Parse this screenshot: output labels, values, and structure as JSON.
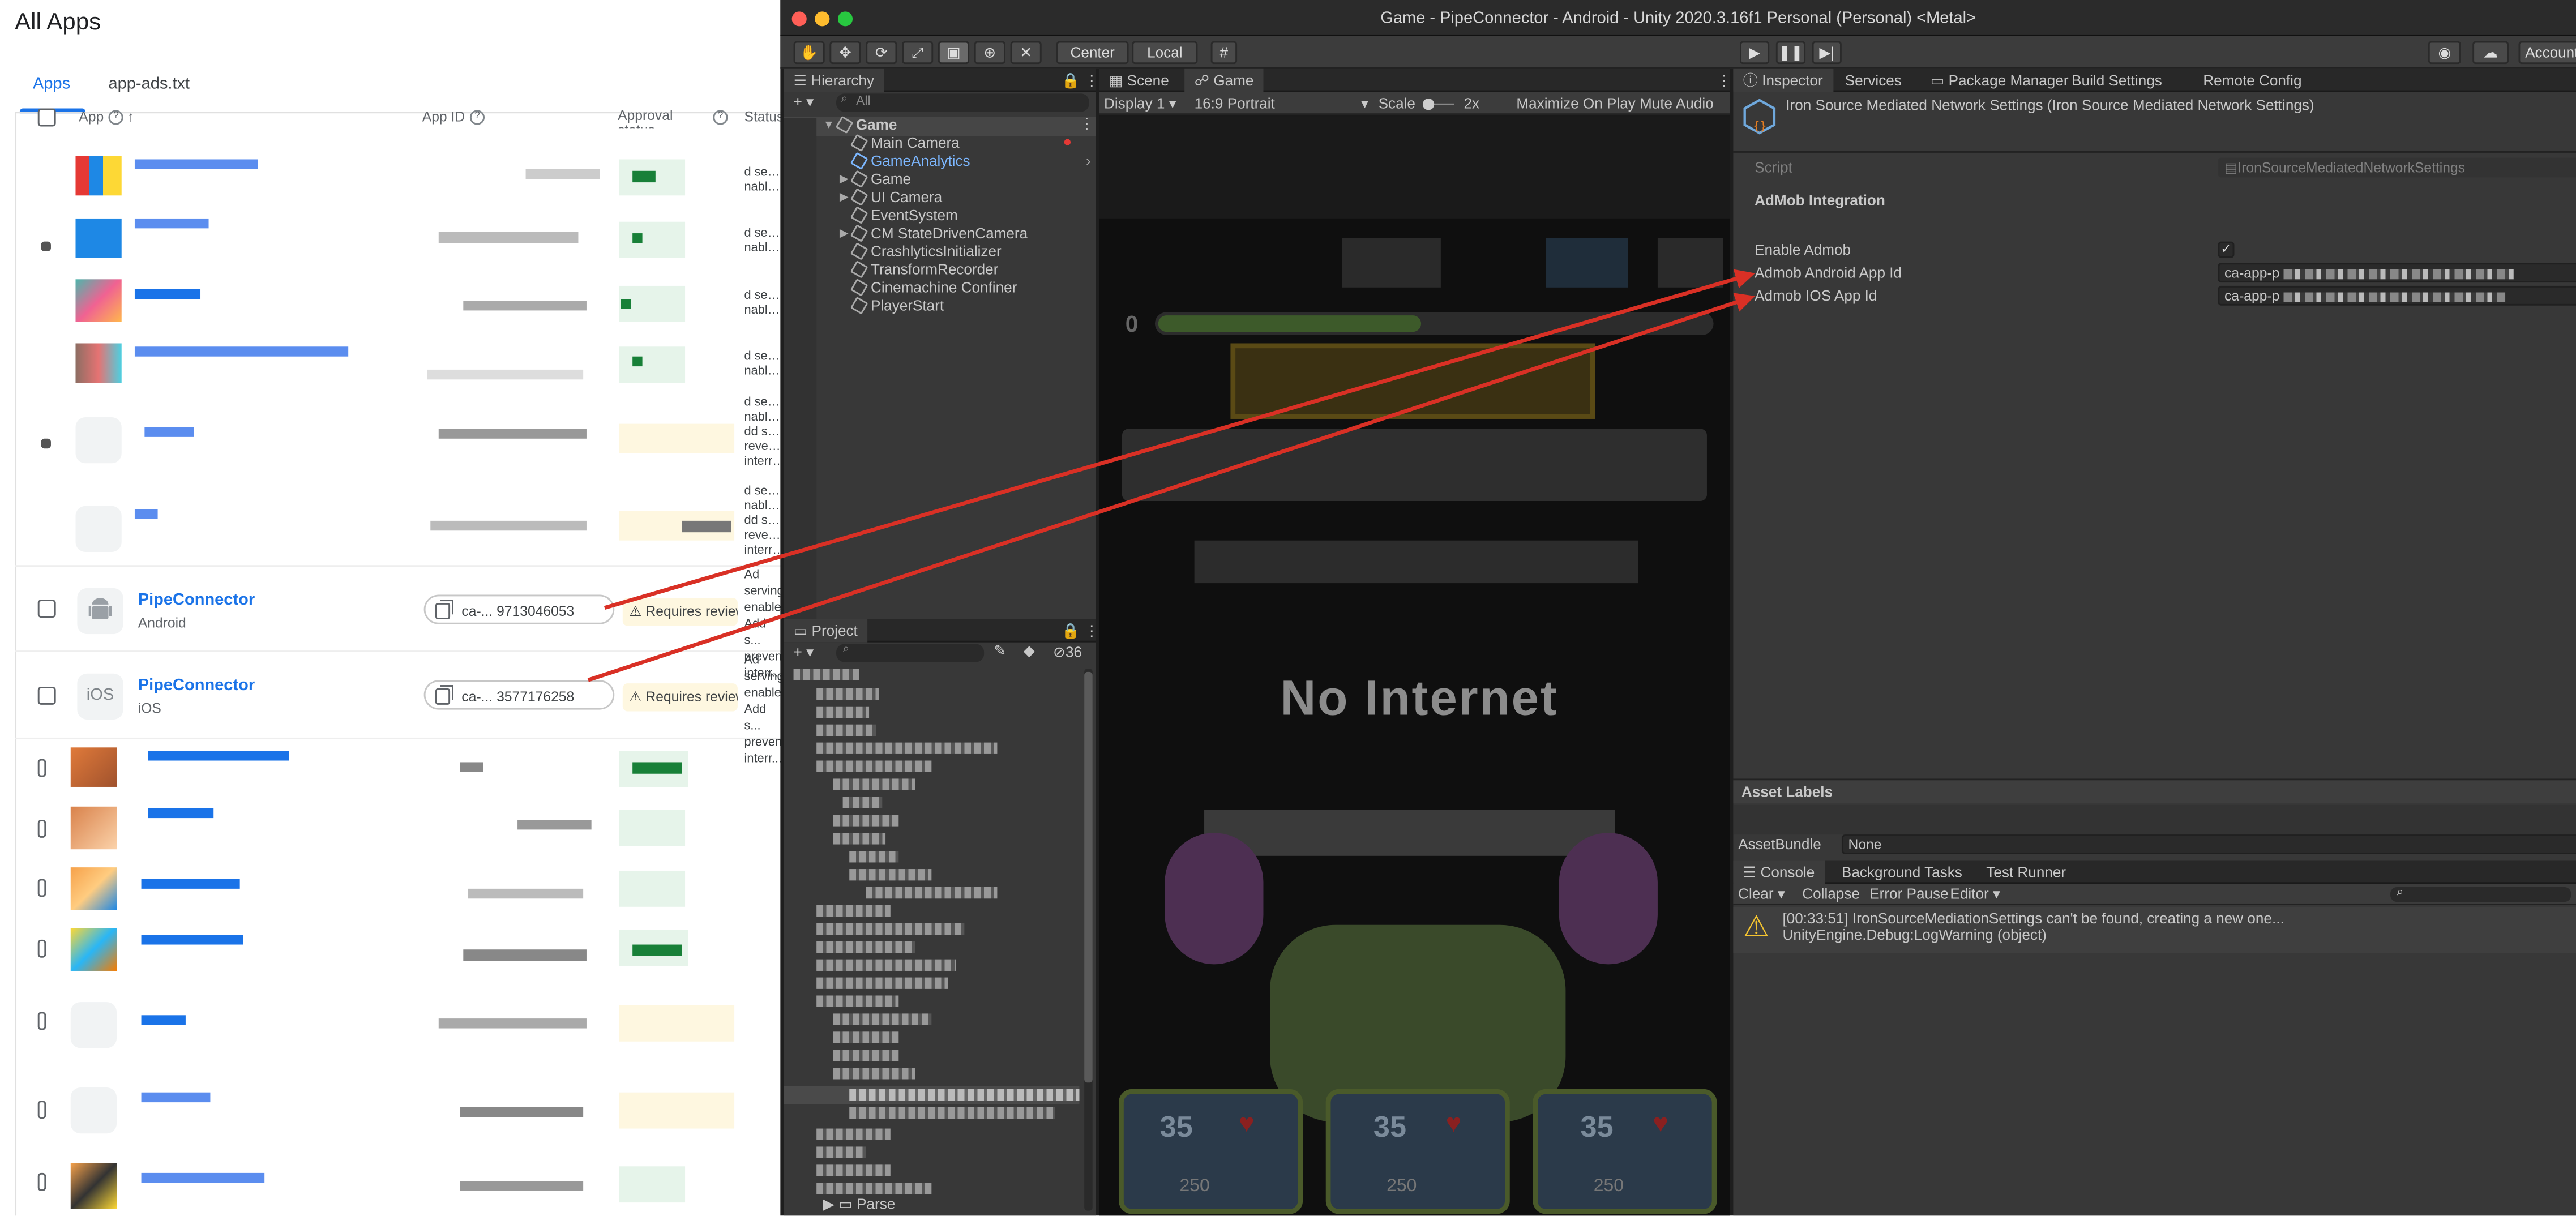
{
  "admob": {
    "page_title": "All Apps",
    "tabs": [
      {
        "label": "Apps"
      },
      {
        "label": "app-ads.txt"
      }
    ],
    "columns": {
      "app": "App",
      "app_id": "App ID",
      "approval": "Approval status",
      "status": "Status"
    },
    "rows": [
      {
        "name": "PipeConnector",
        "platform": "Android",
        "app_id": "ca-... 9713046053",
        "approval": "Requires review",
        "status": "Ad serving enabled. Add s... prevent... interr..."
      },
      {
        "name": "PipeConnector",
        "platform": "iOS",
        "app_id": "ca-... 3577176258",
        "approval": "Requires review",
        "status": "Ad serving enabled. Add s... prevent... interr..."
      }
    ],
    "ios_icon_text": "iOS"
  },
  "unity": {
    "window_title": "Game - PipeConnector - Android - Unity 2020.3.16f1 Personal (Personal) <Metal>",
    "toolbar": {
      "center": "Center",
      "local": "Local",
      "account": "Account"
    },
    "hierarchy": {
      "tab": "Hierarchy",
      "search_placeholder": "All",
      "scene": "Game",
      "items": [
        "Main Camera",
        "GameAnalytics",
        "Game",
        "UI Camera",
        "EventSystem",
        "CM StateDrivenCamera",
        "CrashlyticsInitializer",
        "TransformRecorder",
        "Cinemachine Confiner",
        "PlayerStart"
      ]
    },
    "project": {
      "tab": "Project",
      "count": "36",
      "bottom_item": "Parse"
    },
    "game": {
      "tabs": [
        "Scene",
        "Game"
      ],
      "display": "Display 1",
      "aspect": "16:9 Portrait",
      "scale_label": "Scale",
      "scale_value": "2x",
      "maximize": "Maximize On Play",
      "mute": "Mute Audio",
      "progress_left": "0",
      "no_internet": "No Internet",
      "cards": [
        {
          "value": "35",
          "price": "250"
        },
        {
          "value": "35",
          "price": "250"
        },
        {
          "value": "35",
          "price": "250"
        }
      ]
    },
    "inspector": {
      "tabs": [
        "Inspector",
        "Services",
        "Package Manager",
        "Build Settings",
        "Remote Config"
      ],
      "component_title": "Iron Source Mediated Network Settings (Iron Source Mediated Network Settings)",
      "script_label": "Script",
      "script_value": "IronSourceMediatedNetworkSettings",
      "section": "AdMob Integration",
      "enable_label": "Enable Admob",
      "enable_checked": true,
      "android_label": "Admob Android App Id",
      "android_value": "ca-app-p",
      "ios_label": "Admob IOS App Id",
      "ios_value": "ca-app-p",
      "asset_labels": "Asset Labels",
      "assetbundle_label": "AssetBundle",
      "assetbundle_value": "None"
    },
    "console": {
      "tabs": [
        "Console",
        "Background Tasks",
        "Test Runner"
      ],
      "buttons": [
        "Clear",
        "Collapse",
        "Error Pause",
        "Editor"
      ],
      "message_line1": "[00:33:51] IronSourceMediationSettings can't be found, creating a new one...",
      "message_line2": "UnityEngine.Debug:LogWarning (object)"
    }
  },
  "colors": {
    "arrow": "#d93025",
    "link": "#1a73e8",
    "unity_bg": "#383838",
    "warning": "#f4c430"
  }
}
